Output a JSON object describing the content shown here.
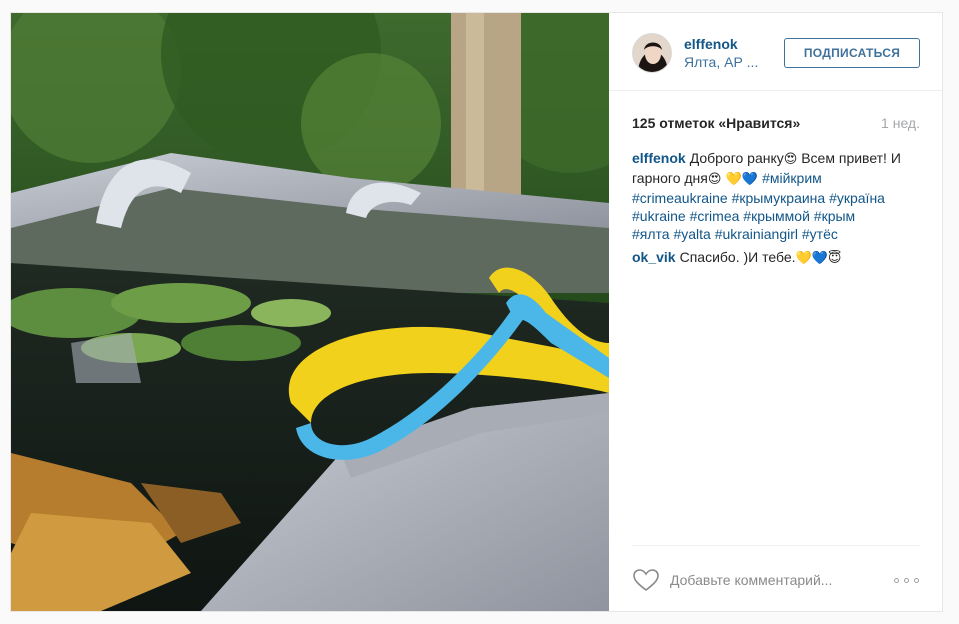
{
  "post": {
    "username": "elffenok",
    "location": "Ялта, АР ...",
    "follow_label": "ПОДПИСАТЬСЯ",
    "likes": "125 отметок «Нравится»",
    "time": "1 нед."
  },
  "caption": {
    "user": "elffenok",
    "text_1": "Доброго ранку",
    "emoji_1": "😍",
    "text_2": " Всем привет! И гарного дня",
    "emoji_2": "😍",
    "emoji_3": " 💛💙 ",
    "tags": [
      "#мійкрим",
      "#crimeaukraine",
      "#крымукраина",
      "#україна",
      "#ukraine",
      "#crimea",
      "#крыммой",
      "#крым",
      "#ялта",
      "#yalta",
      "#ukrainiangirl",
      "#утёс"
    ]
  },
  "reply": {
    "user": "ok_vik",
    "text": "Спасибо. )И тебе.",
    "emoji": "💛💙😇"
  },
  "footer": {
    "placeholder": "Добавьте комментарий...",
    "heart_icon": "heart-outline-icon",
    "more_icon": "ellipsis-icon"
  },
  "colors": {
    "link": "#125688",
    "accent": "#3f729b",
    "muted": "#a5a7aa"
  }
}
